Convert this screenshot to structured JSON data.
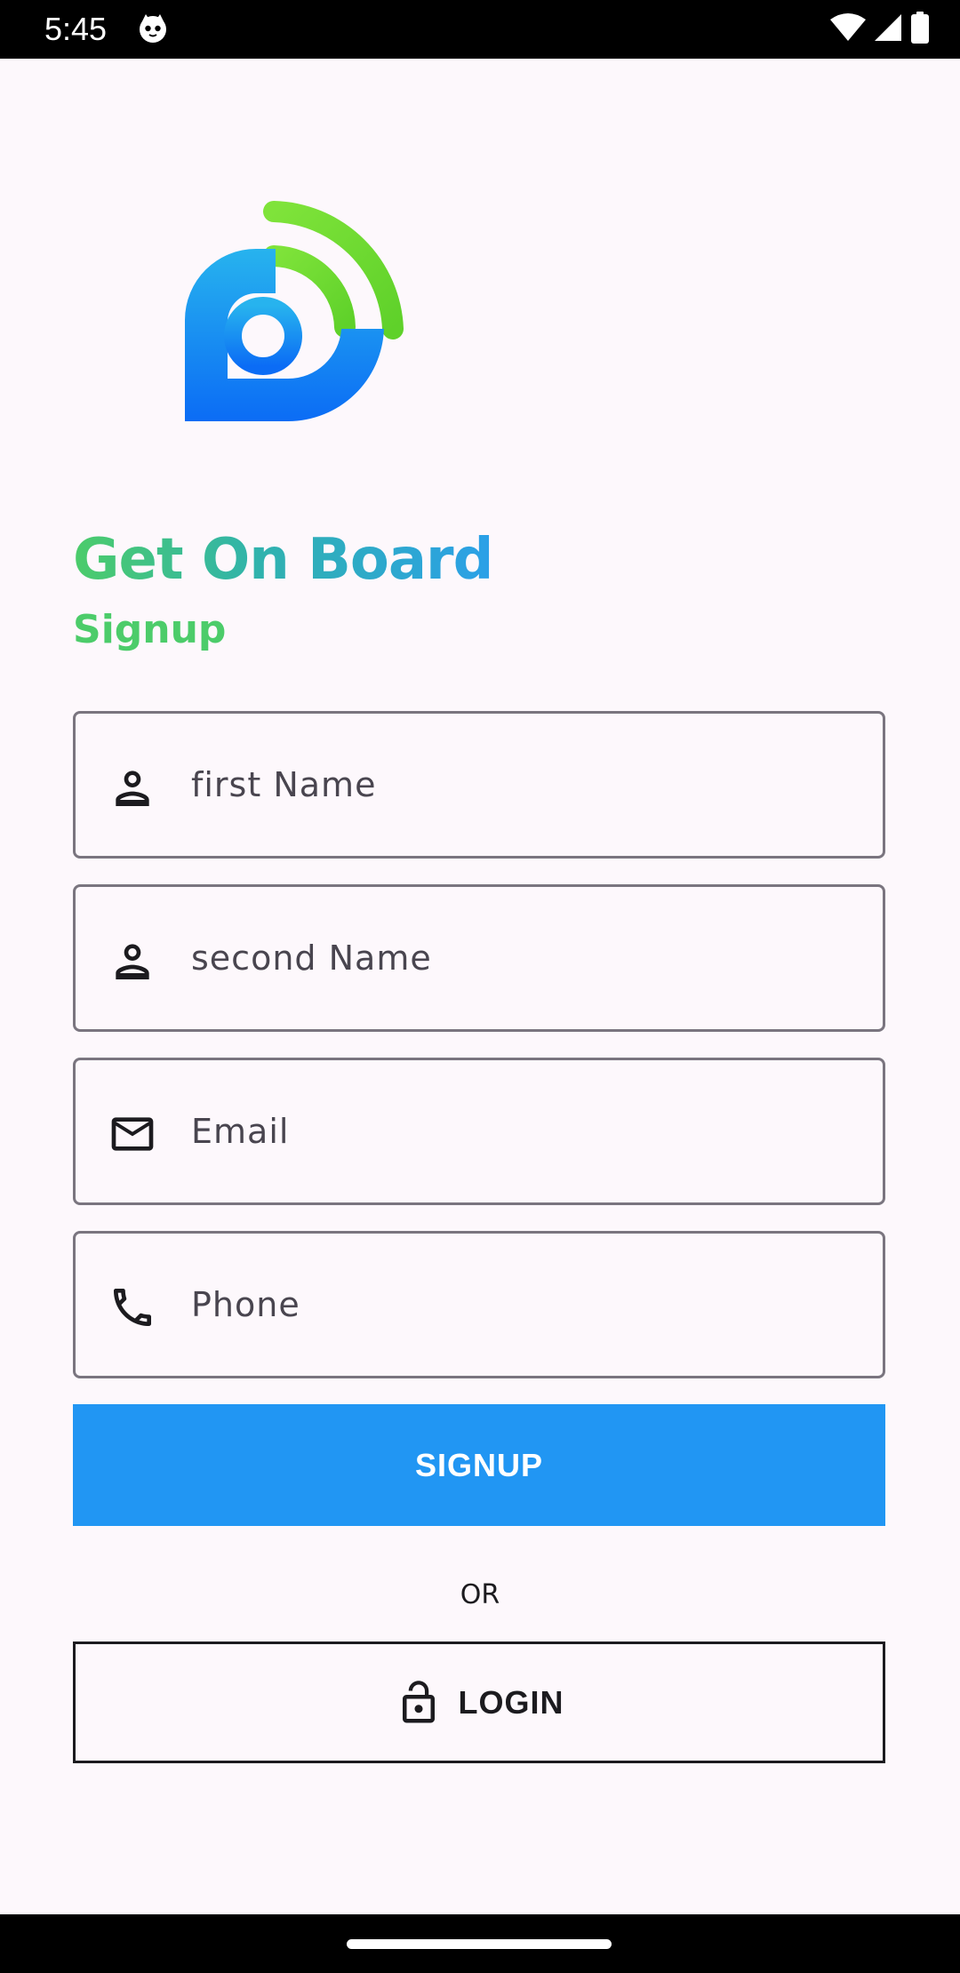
{
  "status_bar": {
    "time": "5:45",
    "icons": [
      "cat-icon",
      "wifi-icon",
      "signal-icon",
      "battery-icon"
    ]
  },
  "logo": {
    "icon": "radio-signal-logo",
    "colors": {
      "blue_top": "#27b3ee",
      "blue_bottom": "#0b6cf5",
      "green": "#6fdc2e"
    }
  },
  "header": {
    "title": "Get On Board",
    "subtitle": "Signup"
  },
  "form": {
    "fields": [
      {
        "placeholder": "first Name",
        "icon": "person-icon"
      },
      {
        "placeholder": "second Name",
        "icon": "person-icon"
      },
      {
        "placeholder": "Email",
        "icon": "mail-icon"
      },
      {
        "placeholder": "Phone",
        "icon": "phone-icon"
      }
    ],
    "signup_label": "SIGNUP",
    "or_label": "OR",
    "login_label": "LOGIN",
    "login_icon": "lock-open-icon"
  },
  "colors": {
    "primary": "#2196f3",
    "title_gradient": [
      "#4ccc6a",
      "#2ba0e8"
    ],
    "background": "#fdf8fc"
  }
}
